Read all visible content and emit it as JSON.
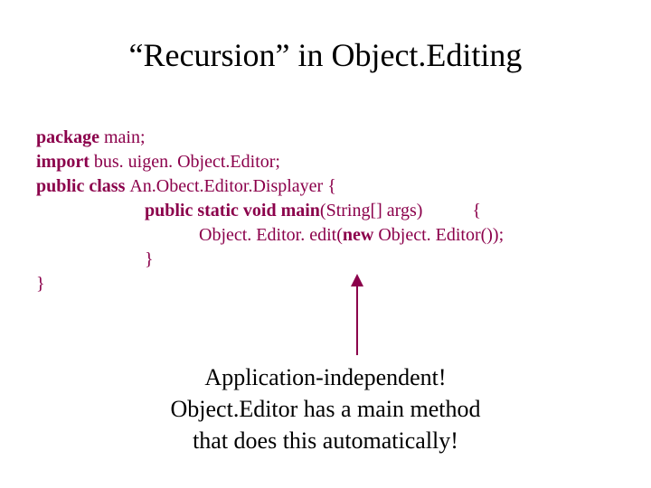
{
  "title": "“Recursion” in Object.Editing",
  "code": {
    "l1_kw": "package ",
    "l1_rest": "main;",
    "l2_kw": "import ",
    "l2_rest": "bus. uigen. Object.Editor;",
    "l3_kw": "public class ",
    "l3_rest": "An.Obect.Editor.Displayer {",
    "l4_kw": "public static void main",
    "l4_mid": "(String[] args)",
    "l4_brace": "{",
    "l5_a": "Object. Editor. edit(",
    "l5_kw": "new ",
    "l5_b": "Object. Editor());",
    "l6": "}",
    "l7": "}"
  },
  "caption": {
    "line1": "Application-independent!",
    "line2": "Object.Editor has a  main method",
    "line3": "that does this automatically!"
  },
  "arrow_color": "#8b004b"
}
